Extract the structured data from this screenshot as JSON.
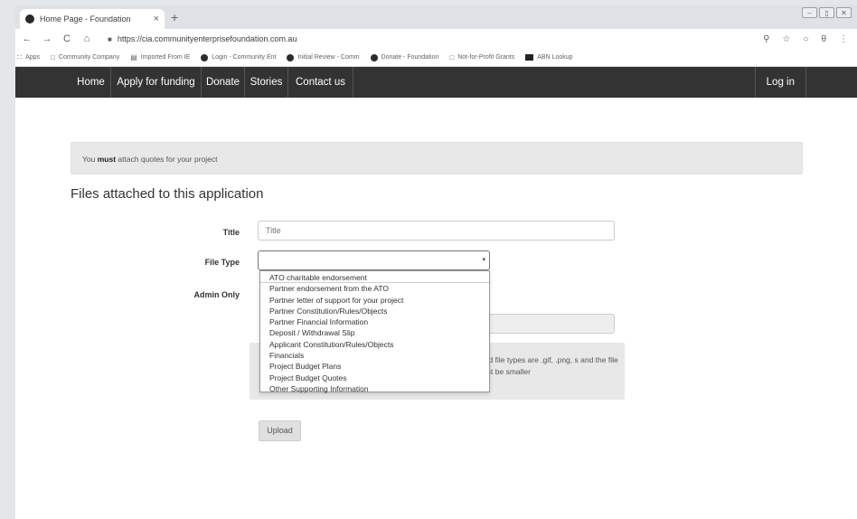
{
  "browser": {
    "tab_title": "Home Page - Foundation",
    "tab_close": "×",
    "new_tab": "+",
    "win_min": "–",
    "win_max": "▯",
    "win_close": "✕",
    "url": "https://cia.communityenterprisefoundation.com.au",
    "nav_back": "←",
    "nav_forward": "→",
    "nav_reload": "C",
    "nav_home": "⌂",
    "right_icons": [
      "⚲",
      "☆",
      "○",
      "θ",
      "⋮"
    ]
  },
  "bookmarks": [
    {
      "icon": "apps",
      "label": "Apps"
    },
    {
      "icon": "page",
      "label": "Community Company"
    },
    {
      "icon": "folder",
      "label": "Imported From IE"
    },
    {
      "icon": "dot",
      "label": "Login - Community Ent"
    },
    {
      "icon": "dot",
      "label": "Initial Review - Comm"
    },
    {
      "icon": "dot",
      "label": "Donate - Foundation"
    },
    {
      "icon": "page",
      "label": "Not-for-Profit Grants"
    },
    {
      "icon": "square",
      "label": "ABN Lookup"
    }
  ],
  "site_nav": {
    "items": [
      "Home",
      "Apply for funding",
      "Donate",
      "Stories",
      "Contact us"
    ],
    "login": "Log in"
  },
  "alert": {
    "prefix": "You ",
    "strong": "must",
    "suffix": " attach quotes for your project"
  },
  "section_title": "Files attached to this application",
  "form": {
    "title_label": "Title",
    "title_placeholder": "Title",
    "file_type_label": "File Type",
    "select_arrow": "▾",
    "admin_only_label": "Admin Only",
    "admin_colon": ":",
    "file_type_options": [
      "ATO charitable endorsement",
      "Partner endorsement from the ATO",
      "Partner letter of support for your project",
      "Partner Constitution/Rules/Objects",
      "Partner Financial Information",
      "Deposit / Withdrawal Slip",
      "Applicant Constitution/Rules/Objects",
      "Financials",
      "Project Budget Plans",
      "Project Budget Quotes",
      "Other Supporting Information"
    ],
    "help_text": "Valid file types are .gif, .png, s and the file must be smaller",
    "upload_label": "Upload"
  }
}
